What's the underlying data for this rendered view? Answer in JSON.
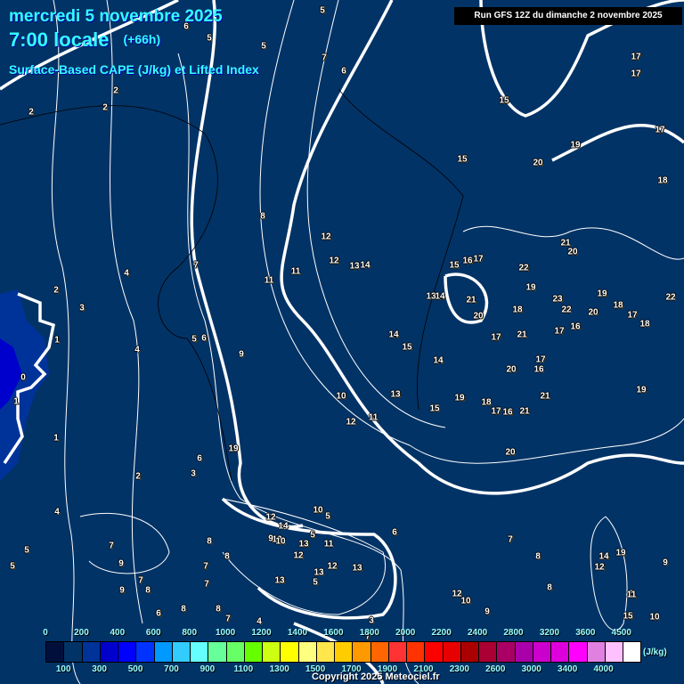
{
  "header": {
    "date": "mercredi 5 novembre 2025",
    "time": "7:00 locale",
    "lead": "(+66h)",
    "parameter": "Surface-Based CAPE (J/kg) et Lifted Index",
    "run": "Run GFS 12Z du dimanche 2 novembre 2025"
  },
  "colorbar": {
    "unit": "(J/kg)",
    "colors": [
      "#00103a",
      "#023366",
      "#003399",
      "#0000cc",
      "#0000ff",
      "#0033ff",
      "#0099ff",
      "#33ccff",
      "#66ffff",
      "#66ff99",
      "#66ff66",
      "#66ff00",
      "#ccff11",
      "#ffff00",
      "#ffff80",
      "#ffe64c",
      "#ffcc00",
      "#ff9900",
      "#ff6600",
      "#ff3333",
      "#ff3300",
      "#ff0000",
      "#e60000",
      "#aa0000",
      "#aa0033",
      "#aa0066",
      "#aa00aa",
      "#cc00cc",
      "#dd00dd",
      "#ff00ff",
      "#e080e0",
      "#ffc0ff",
      "#ffffff"
    ],
    "top_labels": [
      "0",
      "200",
      "400",
      "600",
      "800",
      "1000",
      "1200",
      "1400",
      "1600",
      "1800",
      "2000",
      "2200",
      "2400",
      "2800",
      "3200",
      "3600",
      "4500"
    ],
    "bottom_labels": [
      "100",
      "300",
      "500",
      "700",
      "900",
      "1100",
      "1300",
      "1500",
      "1700",
      "1900",
      "2100",
      "2300",
      "2600",
      "3000",
      "3400",
      "4000"
    ]
  },
  "lifted_index_labels": [
    "5",
    "6",
    "5",
    "5",
    "7",
    "6",
    "2",
    "2",
    "2",
    "17",
    "17",
    "17",
    "18",
    "15",
    "15",
    "19",
    "20",
    "8",
    "12",
    "12",
    "13",
    "14",
    "11",
    "11",
    "4",
    "4",
    "2",
    "3",
    "1",
    "0",
    "1",
    "1",
    "7",
    "5",
    "6",
    "9",
    "15",
    "16",
    "17",
    "22",
    "21",
    "20",
    "19",
    "13",
    "14",
    "14",
    "15",
    "14",
    "21",
    "20",
    "18",
    "17",
    "21",
    "23",
    "22",
    "20",
    "19",
    "18",
    "17",
    "22",
    "19",
    "18",
    "20",
    "17",
    "16",
    "21",
    "17",
    "16",
    "10",
    "12",
    "11",
    "13",
    "15",
    "19",
    "18",
    "17",
    "16",
    "21",
    "20",
    "19",
    "6",
    "3",
    "2",
    "4",
    "7",
    "12",
    "14",
    "12",
    "10",
    "5",
    "5",
    "13",
    "12",
    "11",
    "13",
    "13",
    "12",
    "9",
    "10",
    "9",
    "13",
    "5",
    "7",
    "8",
    "9",
    "7",
    "8",
    "7",
    "12",
    "10",
    "9",
    "8",
    "7",
    "8",
    "6",
    "8",
    "7",
    "4",
    "3",
    "7",
    "6",
    "8",
    "12",
    "14",
    "19",
    "11",
    "15",
    "10",
    "9",
    "5",
    "5",
    "6",
    "8",
    "10"
  ],
  "copyright": "Copyright 2025 Meteociel.fr"
}
